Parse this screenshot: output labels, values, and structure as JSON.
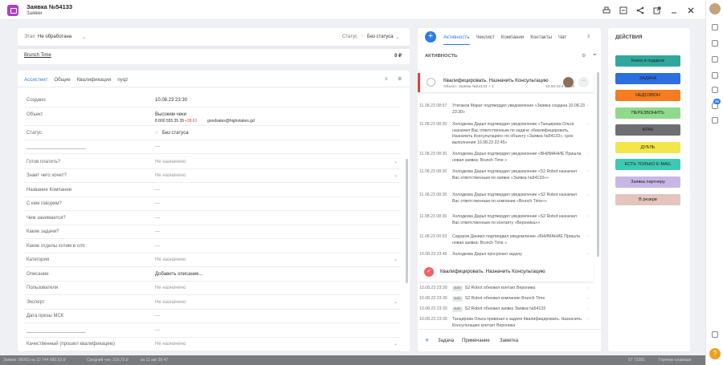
{
  "header": {
    "title": "Заявка №54133",
    "subtitle": "Заявки"
  },
  "stage": {
    "label": "Этап",
    "value": "Не обработана",
    "status_label": "Статус",
    "status_value": "Без статуса",
    "pipeline": "Brunch Time",
    "amount": "0 ₽"
  },
  "tabs": [
    "Ассистент",
    "Общие",
    "Квалификация",
    "nyqz"
  ],
  "fields": [
    {
      "k": "Создано",
      "v": "10.08.23 23:30",
      "dark": true
    },
    {
      "k": "Объект",
      "v": "Высоким чеки",
      "v2": "8 800 555 35 35",
      "v3": "+38.61",
      "v4": "goodsales@highstakes.gd",
      "dark": true
    },
    {
      "k": "Статус",
      "v": "Без статуса",
      "dark": true
    },
    {
      "k": "______________________",
      "v": "—"
    },
    {
      "k": "Готов платить?",
      "v": "Не назначено",
      "sel": true
    },
    {
      "k": "Знает чего хочет?",
      "v": "Не назначено",
      "sel": true
    },
    {
      "k": "Название Компании",
      "v": "—"
    },
    {
      "k": "С кем говорим?",
      "v": "—"
    },
    {
      "k": "Чем занимается?",
      "v": "—"
    },
    {
      "k": "Какие задачи?",
      "v": "—"
    },
    {
      "k": "Какие отделы хотим в crm",
      "v": "—"
    },
    {
      "k": "Категория",
      "v": "Не назначено",
      "sel": true
    },
    {
      "k": "Описание",
      "v": "Добавить описание...",
      "dark": true
    },
    {
      "k": "Пользователи",
      "v": "Не назначено"
    },
    {
      "k": "Эксперт",
      "v": "Не назначено",
      "sel": true
    },
    {
      "k": "Дата презы МСК",
      "v": "—"
    },
    {
      "k": "______________________",
      "v": "—"
    },
    {
      "k": "Качественный (прошел квалификацию)",
      "v": "Не назначено",
      "sel": true
    }
  ],
  "feed": {
    "tabs": [
      "Активность",
      "Чеклист",
      "Компании",
      "Контакты",
      "Чат"
    ],
    "title": "АКТИВНОСТЬ",
    "task": {
      "title": "Квалифицировать. Назначить Консультацию",
      "object": "Объект: Заявка  №54133 + 2",
      "date": "10.08.23 в 23:43"
    },
    "events": [
      {
        "ts": "11.08.23 08:57",
        "tx": "Утигаков Марат подтвердил уведомление «Заявка создана  10.08.23 23:30»"
      },
      {
        "ts": "11.08.23 08:30",
        "tx": "Холодкова Дарья подтвердил уведомление «Танцирева Ольга назначил Вас ответственным по задаче «Квалифицировать. Назначить Консультацию» по объекту «Заявка  №54133», срок выполнения 10.08.23 22:45»"
      },
      {
        "ts": "11.08.23 08:30",
        "tx": "Холодкова Дарья подтвердил уведомление «ВНИМАНИЕ Пришла новая заявка: Brunch Time  »"
      },
      {
        "ts": "11.08.23 08:30",
        "tx": "Холодкова Дарья подтвердил уведомление «S2 Robot назначил Вас ответственным по заявке «Заявка  №54133»»"
      },
      {
        "ts": "11.08.23 08:30",
        "tx": "Холодкова Дарья подтвердил уведомление «S2 Robot назначил Вас ответственным по компании «Brunch Time»»"
      },
      {
        "ts": "11.08.23 08:30",
        "tx": "Холодкова Дарья подтвердил уведомление «S2 Robot назначил Вас ответственным по контакту «Вероника»»"
      },
      {
        "ts": "11.08.23 00:53",
        "tx": "Сидоров Даниил подтвердил уведомление «ВНИМАНИЕ Пришла новая заявка: Brunch Time  »"
      },
      {
        "ts": "10.08.23 23:46",
        "tx": "Холодкова Дарья просрочил задачу"
      }
    ],
    "task2": "Квалифицировать. Назначить Консультацию",
    "events2": [
      {
        "ts": "10.08.23 23:30",
        "tag": "auto",
        "tx": "S2 Robot обновил контакт Вероника"
      },
      {
        "ts": "10.08.23 23:30",
        "tag": "auto",
        "tx": "S2 Robot обновил компанию Brunch Time"
      },
      {
        "ts": "10.08.23 23:30",
        "tag": "auto",
        "tx": "S2 Robot обновил заявку Заявка  №54133"
      },
      {
        "ts": "10.08.23 23:30",
        "tag": "",
        "tx": "Танцирева Ольга привязал к задаче Квалифицировать. Назначить Консультацию контакт Вероника"
      }
    ],
    "bottom": [
      "Задача",
      "Примечание",
      "Заметка"
    ]
  },
  "actions": {
    "title": "ДЕЙСТВИЯ",
    "buttons": [
      {
        "label": "Книга в подарок",
        "color": "#2fa89d"
      },
      {
        "label": "ЗАДАЧА",
        "color": "#2b6fe0"
      },
      {
        "label": "НЕДОЗВОН",
        "color": "#f57c1f"
      },
      {
        "label": "ПЕРЕЗВОНИТЬ",
        "color": "#8fd98a"
      },
      {
        "label": "БРАК",
        "color": "#6d6f72"
      },
      {
        "label": "ДУБЛЬ",
        "color": "#f4e64a"
      },
      {
        "label": "ЕСТЬ ТОЛЬКО E-MAIL",
        "color": "#3ec9b4"
      },
      {
        "label": "Заявка партнеру",
        "color": "#c8b7e6"
      },
      {
        "label": "В резерв",
        "color": "#e3c5bd"
      }
    ]
  },
  "footer": [
    "Заявок: 96993 на 10 744 680,53 ₽",
    "Средний чек: 219,72 ₽",
    "за 11 авг 39 47"
  ],
  "sidebar_badge": "96",
  "footer_right": [
    "57 72281",
    "Горячие клавиши"
  ]
}
